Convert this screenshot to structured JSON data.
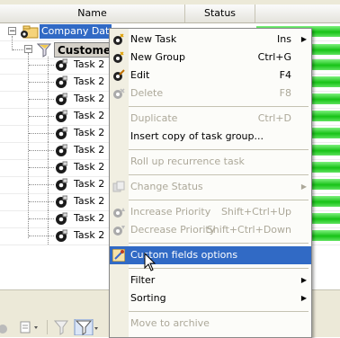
{
  "grid": {
    "columns": [
      "Name",
      "Status"
    ],
    "root_label": "Company Datab",
    "group_label": "Customer",
    "task_label": "Task 2",
    "task_count": 11
  },
  "menu": {
    "items": [
      {
        "label": "New Task",
        "shortcut": "Ins",
        "submenu": true,
        "disabled": false,
        "icon": "new-task-icon"
      },
      {
        "label": "New Group",
        "shortcut": "Ctrl+G",
        "disabled": false,
        "icon": "new-group-icon"
      },
      {
        "label": "Edit",
        "shortcut": "F4",
        "disabled": false,
        "icon": "edit-icon"
      },
      {
        "label": "Delete",
        "shortcut": "F8",
        "disabled": true,
        "icon": "delete-icon"
      },
      {
        "label": "Duplicate",
        "shortcut": "Ctrl+D",
        "disabled": true
      },
      {
        "label": "Insert copy of task group...",
        "shortcut": "",
        "disabled": false
      },
      {
        "label": "Roll up recurrence task",
        "shortcut": "",
        "disabled": true
      },
      {
        "label": "Change Status",
        "shortcut": "",
        "submenu": true,
        "disabled": true,
        "icon": "change-status-icon"
      },
      {
        "label": "Increase Priority",
        "shortcut": "Shift+Ctrl+Up",
        "disabled": true,
        "icon": "increase-priority-icon"
      },
      {
        "label": "Decrease Priority",
        "shortcut": "Shift+Ctrl+Down",
        "disabled": true,
        "icon": "decrease-priority-icon"
      },
      {
        "label": "Custom fields options",
        "shortcut": "",
        "disabled": false,
        "highlighted": true,
        "icon": "custom-fields-icon"
      },
      {
        "label": "Filter",
        "shortcut": "",
        "submenu": true,
        "disabled": false
      },
      {
        "label": "Sorting",
        "shortcut": "",
        "submenu": true,
        "disabled": false
      },
      {
        "label": "Move to archive",
        "shortcut": "",
        "disabled": true
      }
    ]
  },
  "colors": {
    "selection": "#316ac5",
    "progress_green": "#17c217",
    "menu_bg": "#fcfcf9",
    "disabled_text": "#aca899"
  }
}
